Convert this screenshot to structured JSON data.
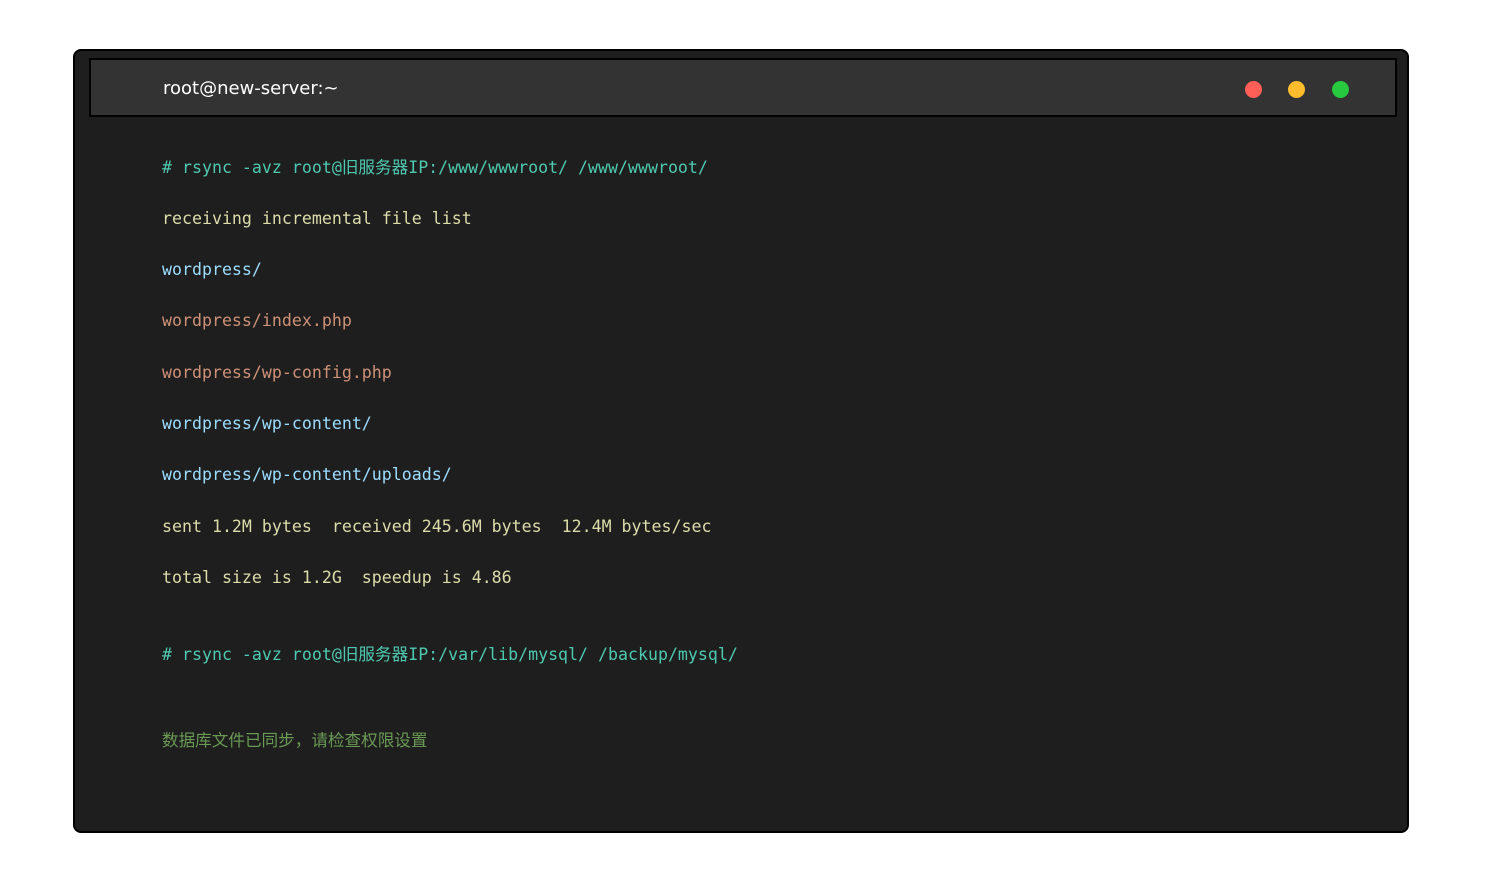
{
  "window": {
    "title": "root@new-server:~",
    "controls": {
      "close_color": "#ff5f56",
      "minimize_color": "#ffbd2e",
      "maximize_color": "#27c93f"
    }
  },
  "colors": {
    "background": "#1e1e1e",
    "title_bar": "#333333",
    "command": "#4ec9b0",
    "text": "#dcdcaa",
    "directory": "#9cdcfe",
    "file": "#ce9178",
    "status": "#6a9955"
  },
  "terminal": {
    "command_1": "# rsync -avz root@旧服务器IP:/www/wwwroot/ /www/wwwroot/",
    "output_1": "receiving incremental file list",
    "output_2": "wordpress/",
    "output_3": "wordpress/index.php",
    "output_4": "wordpress/wp-config.php",
    "output_5": "wordpress/wp-content/",
    "output_6": "wordpress/wp-content/uploads/",
    "output_7": "sent 1.2M bytes  received 245.6M bytes  12.4M bytes/sec",
    "output_8": "total size is 1.2G  speedup is 4.86",
    "command_2": "# rsync -avz root@旧服务器IP:/var/lib/mysql/ /backup/mysql/",
    "status_message": "数据库文件已同步，请检查权限设置"
  }
}
